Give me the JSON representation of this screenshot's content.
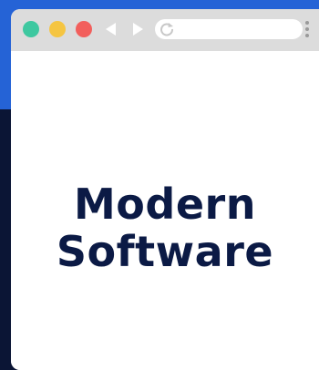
{
  "headline": {
    "line1": "Modern",
    "line2": "Software"
  },
  "window_controls": {
    "close_color": "#3ec8a0",
    "minimize_color": "#f5c542",
    "maximize_color": "#f25f5c"
  },
  "icons": {
    "back": "back-arrow-icon",
    "forward": "forward-arrow-icon",
    "reload": "reload-icon",
    "menu": "kebab-menu-icon"
  },
  "colors": {
    "background_top": "#2563d6",
    "background_bottom": "#0b1535",
    "toolbar": "#dcdcdc",
    "headline_text": "#0b1a45"
  }
}
